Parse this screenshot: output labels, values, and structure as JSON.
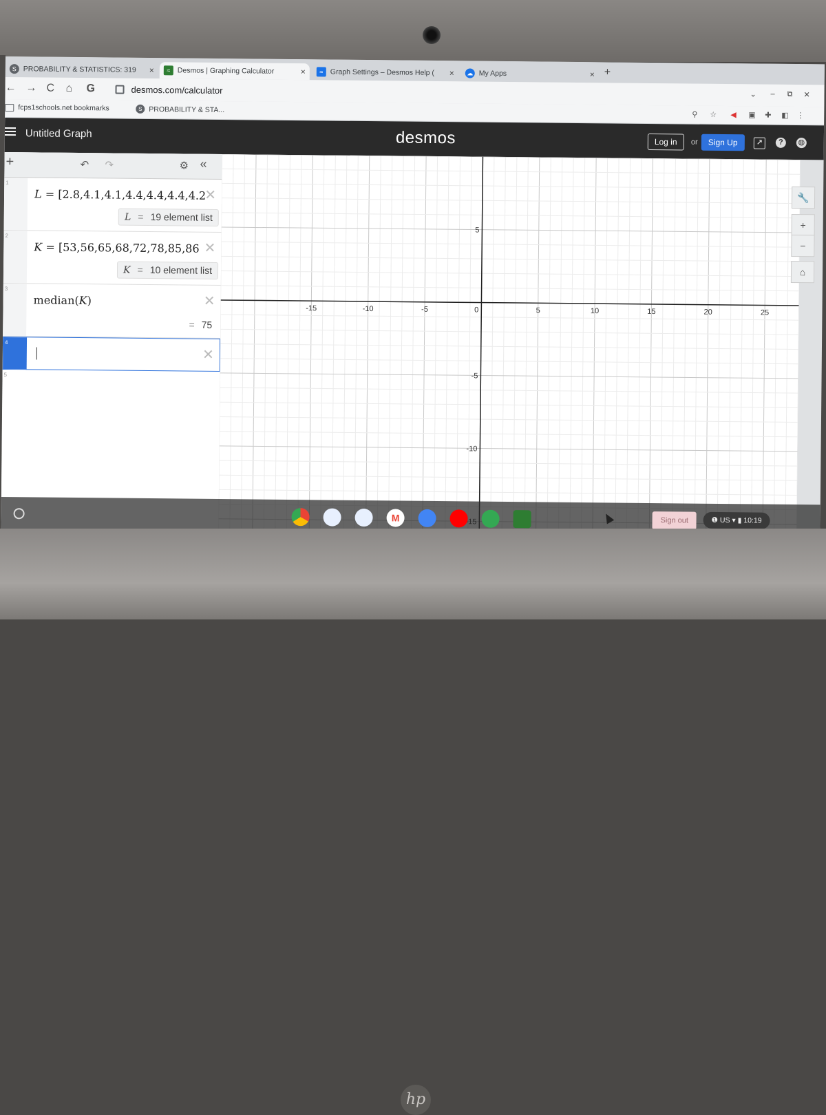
{
  "browser": {
    "tabs": [
      {
        "label": "PROBABILITY & STATISTICS: 319",
        "close": "×"
      },
      {
        "label": "Desmos | Graphing Calculator",
        "close": "×"
      },
      {
        "label": "Graph Settings – Desmos Help (",
        "close": "×"
      },
      {
        "label": "My Apps",
        "close": "×"
      }
    ],
    "new_tab": "+",
    "url": "desmos.com/calculator",
    "bookmarks": [
      {
        "label": "fcps1schools.net bookmarks"
      },
      {
        "label": "PROBABILITY & STA..."
      }
    ]
  },
  "desmos": {
    "graph_title": "Untitled Graph",
    "brand": "desmos",
    "login_label": "Log in",
    "or_label": "or",
    "signup_label": "Sign Up",
    "help_icon": "?",
    "expressions": [
      {
        "num": "1",
        "var": "L",
        "assign": "=",
        "list": "[2.8,4.1,4.1,4.4,4.4,4.4,4.2,4.(",
        "eval_var": "L",
        "eval_eq": "=",
        "eval_value": "19 element list"
      },
      {
        "num": "2",
        "var": "K",
        "assign": "=",
        "list": "[53,56,65,68,72,78,85,86",
        "eval_var": "K",
        "eval_eq": "=",
        "eval_value": "10 element list"
      },
      {
        "num": "3",
        "func": "median",
        "arg": "K",
        "eval_eq": "=",
        "eval_value": "75"
      },
      {
        "num": "4"
      },
      {
        "num": "5"
      }
    ],
    "axis": {
      "x_ticks": [
        "-15",
        "-10",
        "-5",
        "0",
        "5",
        "10",
        "15",
        "20",
        "25"
      ],
      "y_ticks": [
        "5",
        "-5",
        "-10",
        "-15"
      ],
      "x_range": [
        -23,
        28
      ],
      "y_range": [
        -16,
        10
      ],
      "grid": true
    }
  },
  "os": {
    "sign_out": "Sign out",
    "locale": "US",
    "time": "10:19"
  },
  "device": {
    "logo": "hp"
  }
}
